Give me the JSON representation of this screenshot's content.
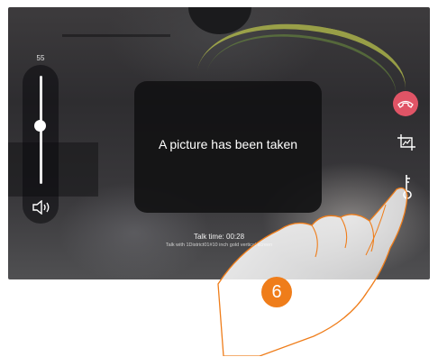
{
  "volume": {
    "value_label": "55",
    "level_percent": 55,
    "icon": "speaker-icon"
  },
  "message": {
    "text": "A picture has been taken"
  },
  "call": {
    "talk_time": "Talk time: 00:28",
    "talk_with": "Talk with 1District01#10 inch gold vertical screen"
  },
  "controls": {
    "end_call_icon": "hang-up-icon",
    "snapshot_icon": "snapshot-icon",
    "door_icon": "door-key-icon",
    "end_call_color": "#e05466"
  },
  "step": {
    "number": "6",
    "color": "#ef7d1a"
  }
}
